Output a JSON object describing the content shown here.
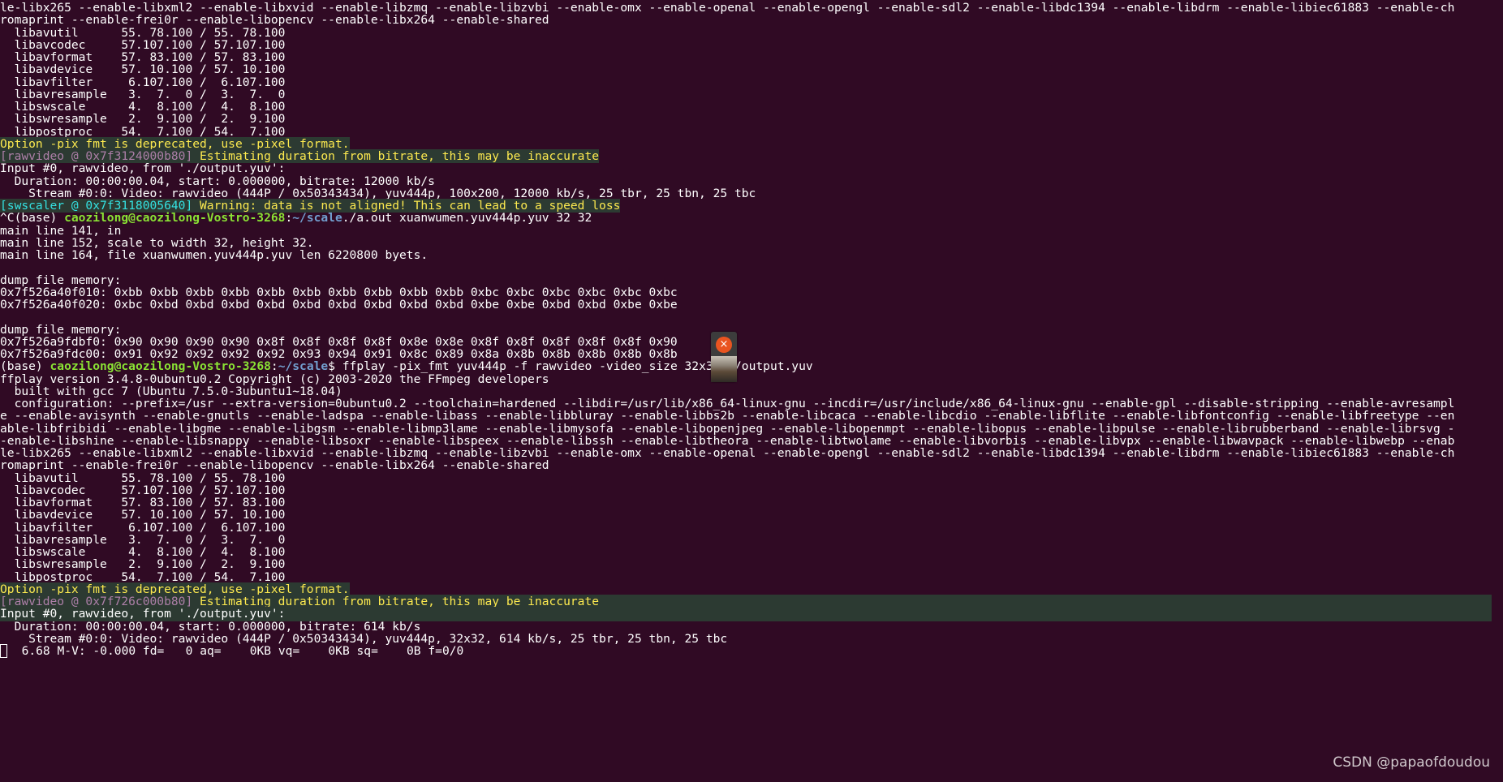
{
  "terminal": {
    "lines": [
      {
        "segments": [
          {
            "text": "le-libx265 --enable-libxml2 --enable-libxvid --enable-libzmq --enable-libzvbi --enable-omx --enable-openal --enable-opengl --enable-sdl2 --enable-libdc1394 --enable-libdrm --enable-libiec61883 --enable-ch"
          }
        ]
      },
      {
        "segments": [
          {
            "text": "romaprint --enable-frei0r --enable-libopencv --enable-libx264 --enable-shared"
          }
        ]
      },
      {
        "segments": [
          {
            "text": "  libavutil      55. 78.100 / 55. 78.100"
          }
        ]
      },
      {
        "segments": [
          {
            "text": "  libavcodec     57.107.100 / 57.107.100"
          }
        ]
      },
      {
        "segments": [
          {
            "text": "  libavformat    57. 83.100 / 57. 83.100"
          }
        ]
      },
      {
        "segments": [
          {
            "text": "  libavdevice    57. 10.100 / 57. 10.100"
          }
        ]
      },
      {
        "segments": [
          {
            "text": "  libavfilter     6.107.100 /  6.107.100"
          }
        ]
      },
      {
        "segments": [
          {
            "text": "  libavresample   3.  7.  0 /  3.  7.  0"
          }
        ]
      },
      {
        "segments": [
          {
            "text": "  libswscale      4.  8.100 /  4.  8.100"
          }
        ]
      },
      {
        "segments": [
          {
            "text": "  libswresample   2.  9.100 /  2.  9.100"
          }
        ]
      },
      {
        "segments": [
          {
            "text": "  libpostproc    54.  7.100 / 54.  7.100"
          }
        ]
      },
      {
        "hl": "short",
        "segments": [
          {
            "text": "Option -pix_fmt is deprecated, use -pixel_format.",
            "cls": "warn"
          }
        ]
      },
      {
        "hl": "short",
        "segments": [
          {
            "text": "[rawvideo @ 0x7f3124000b80] ",
            "cls": "magenta"
          },
          {
            "text": "Estimating duration from bitrate, this may be inaccurate",
            "cls": "warn"
          }
        ]
      },
      {
        "segments": [
          {
            "text": "Input #0, rawvideo, from './output.yuv':"
          }
        ]
      },
      {
        "segments": [
          {
            "text": "  Duration: 00:00:00.04, start: 0.000000, bitrate: 12000 kb/s"
          }
        ]
      },
      {
        "segments": [
          {
            "text": "    Stream #0:0: Video: rawvideo (444P / 0x50343434), yuv444p, 100x200, 12000 kb/s, 25 tbr, 25 tbn, 25 tbc"
          }
        ]
      },
      {
        "hl": "short",
        "segments": [
          {
            "text": "[swscaler @ 0x7f3118005640] ",
            "cls": "cyan-tag"
          },
          {
            "text": "Warning: data is not aligned! This can lead to a speed loss",
            "cls": "warn"
          }
        ]
      },
      {
        "segments": [
          {
            "text": "^C(base) "
          },
          {
            "text": "caozilong@caozilong-Vostro-3268",
            "cls": "user"
          },
          {
            "text": ":"
          },
          {
            "text": "~/scale",
            "cls": "path"
          },
          {
            "text": "./a.out xuanwumen.yuv444p.yuv 32 32"
          }
        ]
      },
      {
        "segments": [
          {
            "text": "main line 141, in"
          }
        ]
      },
      {
        "segments": [
          {
            "text": "main line 152, scale to width 32, height 32."
          }
        ]
      },
      {
        "segments": [
          {
            "text": "main line 164, file xuanwumen.yuv444p.yuv len 6220800 byets."
          }
        ]
      },
      {
        "segments": [
          {
            "text": ""
          }
        ]
      },
      {
        "segments": [
          {
            "text": "dump file memory:"
          }
        ]
      },
      {
        "segments": [
          {
            "text": "0x7f526a40f010: 0xbb 0xbb 0xbb 0xbb 0xbb 0xbb 0xbb 0xbb 0xbb 0xbb 0xbc 0xbc 0xbc 0xbc 0xbc 0xbc"
          }
        ]
      },
      {
        "segments": [
          {
            "text": "0x7f526a40f020: 0xbc 0xbd 0xbd 0xbd 0xbd 0xbd 0xbd 0xbd 0xbd 0xbd 0xbe 0xbe 0xbd 0xbd 0xbe 0xbe"
          }
        ]
      },
      {
        "segments": [
          {
            "text": ""
          }
        ]
      },
      {
        "segments": [
          {
            "text": "dump file memory:"
          }
        ]
      },
      {
        "segments": [
          {
            "text": "0x7f526a9fdbf0: 0x90 0x90 0x90 0x90 0x8f 0x8f 0x8f 0x8f 0x8e 0x8e 0x8f 0x8f 0x8f 0x8f 0x8f 0x90"
          }
        ]
      },
      {
        "segments": [
          {
            "text": "0x7f526a9fdc00: 0x91 0x92 0x92 0x92 0x92 0x93 0x94 0x91 0x8c 0x89 0x8a 0x8b 0x8b 0x8b 0x8b 0x8b"
          }
        ]
      },
      {
        "segments": [
          {
            "text": "(base) "
          },
          {
            "text": "caozilong@caozilong-Vostro-3268",
            "cls": "user"
          },
          {
            "text": ":"
          },
          {
            "text": "~/scale",
            "cls": "path"
          },
          {
            "text": "$ ffplay -pix_fmt yuv444p -f rawvideo -video_size 32x32 ./output.yuv"
          }
        ]
      },
      {
        "segments": [
          {
            "text": "ffplay version 3.4.8-0ubuntu0.2 Copyright (c) 2003-2020 the FFmpeg developers"
          }
        ]
      },
      {
        "segments": [
          {
            "text": "  built with gcc 7 (Ubuntu 7.5.0-3ubuntu1~18.04)"
          }
        ]
      },
      {
        "segments": [
          {
            "text": "  configuration: --prefix=/usr --extra-version=0ubuntu0.2 --toolchain=hardened --libdir=/usr/lib/x86_64-linux-gnu --incdir=/usr/include/x86_64-linux-gnu --enable-gpl --disable-stripping --enable-avresampl"
          }
        ]
      },
      {
        "segments": [
          {
            "text": "e --enable-avisynth --enable-gnutls --enable-ladspa --enable-libass --enable-libbluray --enable-libbs2b --enable-libcaca --enable-libcdio --enable-libflite --enable-libfontconfig --enable-libfreetype --en"
          }
        ]
      },
      {
        "segments": [
          {
            "text": "able-libfribidi --enable-libgme --enable-libgsm --enable-libmp3lame --enable-libmysofa --enable-libopenjpeg --enable-libopenmpt --enable-libopus --enable-libpulse --enable-librubberband --enable-librsvg -"
          }
        ]
      },
      {
        "segments": [
          {
            "text": "-enable-libshine --enable-libsnappy --enable-libsoxr --enable-libspeex --enable-libssh --enable-libtheora --enable-libtwolame --enable-libvorbis --enable-libvpx --enable-libwavpack --enable-libwebp --enab"
          }
        ]
      },
      {
        "segments": [
          {
            "text": "le-libx265 --enable-libxml2 --enable-libxvid --enable-libzmq --enable-libzvbi --enable-omx --enable-openal --enable-opengl --enable-sdl2 --enable-libdc1394 --enable-libdrm --enable-libiec61883 --enable-ch"
          }
        ]
      },
      {
        "segments": [
          {
            "text": "romaprint --enable-frei0r --enable-libopencv --enable-libx264 --enable-shared"
          }
        ]
      },
      {
        "segments": [
          {
            "text": "  libavutil      55. 78.100 / 55. 78.100"
          }
        ]
      },
      {
        "segments": [
          {
            "text": "  libavcodec     57.107.100 / 57.107.100"
          }
        ]
      },
      {
        "segments": [
          {
            "text": "  libavformat    57. 83.100 / 57. 83.100"
          }
        ]
      },
      {
        "segments": [
          {
            "text": "  libavdevice    57. 10.100 / 57. 10.100"
          }
        ]
      },
      {
        "segments": [
          {
            "text": "  libavfilter     6.107.100 /  6.107.100"
          }
        ]
      },
      {
        "segments": [
          {
            "text": "  libavresample   3.  7.  0 /  3.  7.  0"
          }
        ]
      },
      {
        "segments": [
          {
            "text": "  libswscale      4.  8.100 /  4.  8.100"
          }
        ]
      },
      {
        "segments": [
          {
            "text": "  libswresample   2.  9.100 /  2.  9.100"
          }
        ]
      },
      {
        "segments": [
          {
            "text": "  libpostproc    54.  7.100 / 54.  7.100"
          }
        ]
      },
      {
        "hl": "short",
        "segments": [
          {
            "text": "Option -pix_fmt is deprecated, use -pixel_format.",
            "cls": "warn"
          }
        ]
      },
      {
        "hl": "full",
        "segments": [
          {
            "text": "[rawvideo @ 0x7f726c000b80] ",
            "cls": "magenta"
          },
          {
            "text": "Estimating duration from bitrate, this may be inaccurate",
            "cls": "warn"
          }
        ]
      },
      {
        "hl": "full",
        "segments": [
          {
            "text": "Input #0, rawvideo, from './output.yuv':"
          }
        ]
      },
      {
        "segments": [
          {
            "text": "  Duration: 00:00:00.04, start: 0.000000, bitrate: 614 kb/s"
          }
        ]
      },
      {
        "segments": [
          {
            "text": "    Stream #0:0: Video: rawvideo (444P / 0x50343434), yuv444p, 32x32, 614 kb/s, 25 tbr, 25 tbn, 25 tbc"
          }
        ]
      },
      {
        "cursor": true,
        "segments": [
          {
            "text": "  6.68 M-V: -0.000 fd=   0 aq=    0KB vq=    0KB sq=    0B f=0/0"
          }
        ]
      }
    ]
  },
  "ffplay_window": {
    "close_icon": "close-icon",
    "close_glyph": "×"
  },
  "watermark": "CSDN @papaofdoudou",
  "colors": {
    "background": "#300a24",
    "user": "#8ae234",
    "path": "#729fcf",
    "warning": "#fce94f",
    "tag": "#ad7fa8"
  }
}
